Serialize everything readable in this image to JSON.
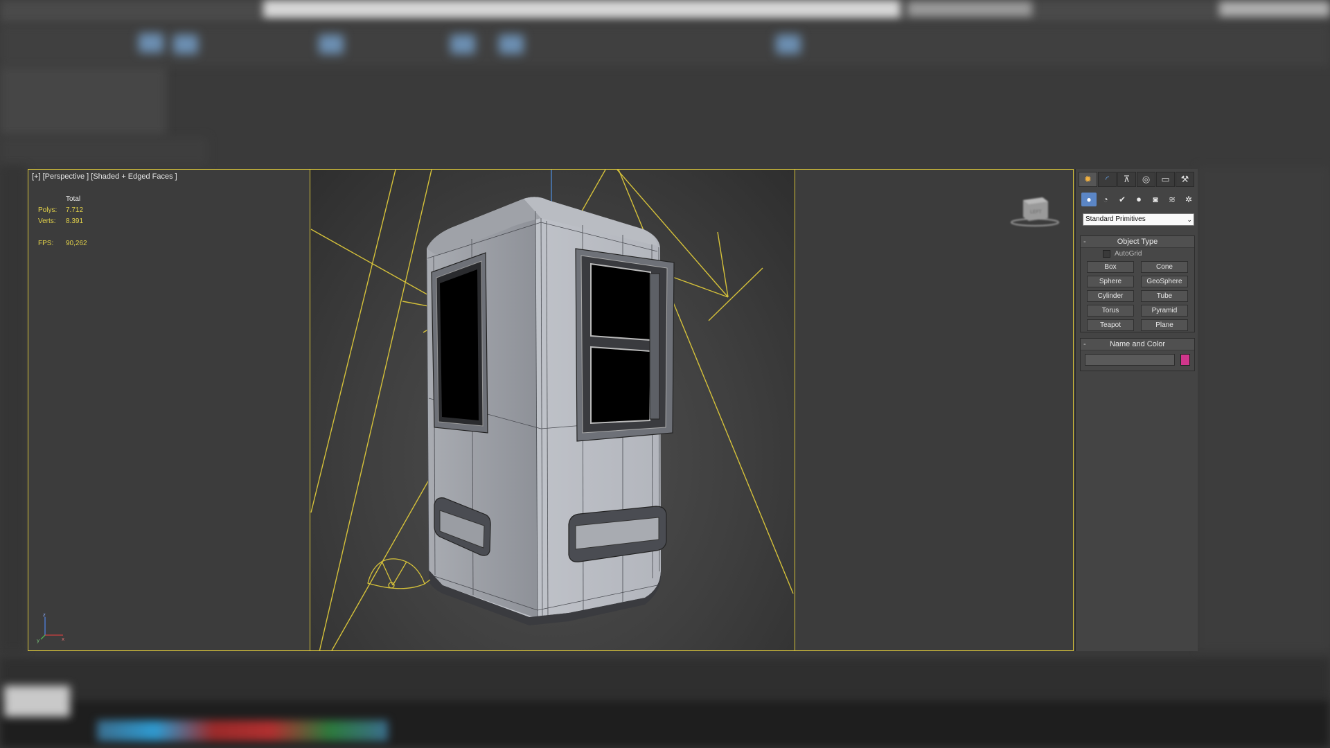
{
  "viewport": {
    "label": "[+] [Perspective ] [Shaded + Edged Faces ]",
    "stats": {
      "header": "Total",
      "polys_label": "Polys:",
      "polys_value": "7.712",
      "verts_label": "Verts:",
      "verts_value": "8.391",
      "fps_label": "FPS:",
      "fps_value": "90,262"
    },
    "axis_labels": {
      "z": "z",
      "y": "y",
      "x": "x"
    },
    "viewcube_label": "LEFT"
  },
  "command_panel": {
    "tabs": [
      {
        "icon": "create-icon",
        "glyph": "✹"
      },
      {
        "icon": "modify-icon",
        "glyph": "◜"
      },
      {
        "icon": "hierarchy-icon",
        "glyph": "⊼"
      },
      {
        "icon": "motion-icon",
        "glyph": "◎"
      },
      {
        "icon": "display-icon",
        "glyph": "▭"
      },
      {
        "icon": "utilities-icon",
        "glyph": "⚒"
      }
    ],
    "subtabs": [
      {
        "icon": "geometry-icon",
        "glyph": "●"
      },
      {
        "icon": "shapes-icon",
        "glyph": "◔"
      },
      {
        "icon": "lights-icon",
        "glyph": "✔"
      },
      {
        "icon": "cameras-icon",
        "glyph": "⏺"
      },
      {
        "icon": "helpers-icon",
        "glyph": "◙"
      },
      {
        "icon": "spacewarps-icon",
        "glyph": "≋"
      },
      {
        "icon": "systems-icon",
        "glyph": "✲"
      }
    ],
    "category": "Standard Primitives",
    "object_type": {
      "title": "Object Type",
      "autogrid": "AutoGrid",
      "buttons": [
        "Box",
        "Cone",
        "Sphere",
        "GeoSphere",
        "Cylinder",
        "Tube",
        "Torus",
        "Pyramid",
        "Teapot",
        "Plane"
      ]
    },
    "name_and_color": {
      "title": "Name and Color",
      "name_value": "",
      "color": "#d0368c"
    },
    "collapse_glyph": "-"
  },
  "colors": {
    "light_lines": "#d6c23a",
    "selection_accent": "#5b86c6",
    "background": "#3a3a3a"
  }
}
